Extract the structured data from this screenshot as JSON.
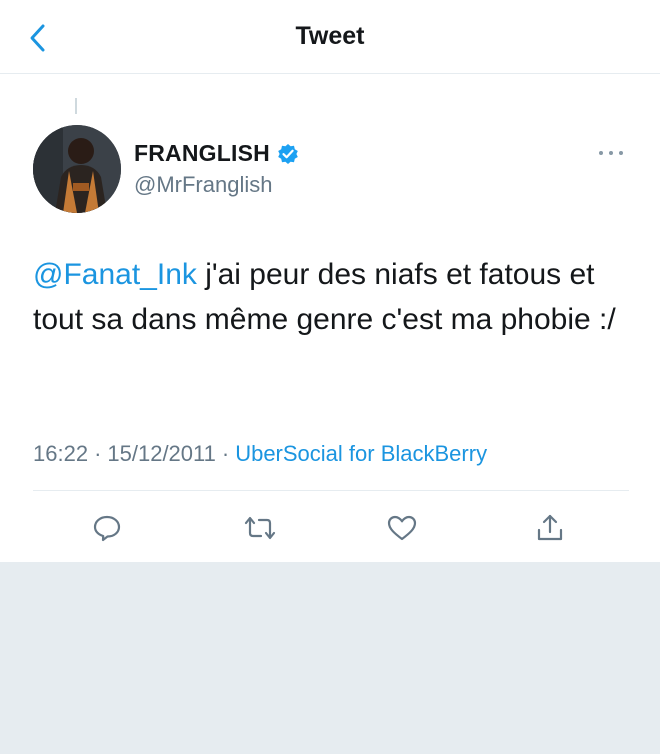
{
  "header": {
    "title": "Tweet"
  },
  "author": {
    "name": "FRANGLISH",
    "handle": "@MrFranglish",
    "verified": true
  },
  "tweet": {
    "mention": "@Fanat_Ink",
    "text": " j'ai peur des niafs et fatous et tout sa dans même genre c'est ma phobie :/"
  },
  "meta": {
    "time": "16:22",
    "separator": "·",
    "date": "15/12/2011",
    "source": "UberSocial for BlackBerry"
  },
  "icons": {
    "back": "chevron-left-icon",
    "more": "more-horizontal-icon",
    "reply": "reply-icon",
    "retweet": "retweet-icon",
    "like": "heart-icon",
    "share": "share-icon",
    "verified": "verified-badge-icon"
  },
  "colors": {
    "accent": "#1b95e0",
    "text": "#14171a",
    "secondary": "#657786",
    "background_grey": "#e6ecf0"
  }
}
